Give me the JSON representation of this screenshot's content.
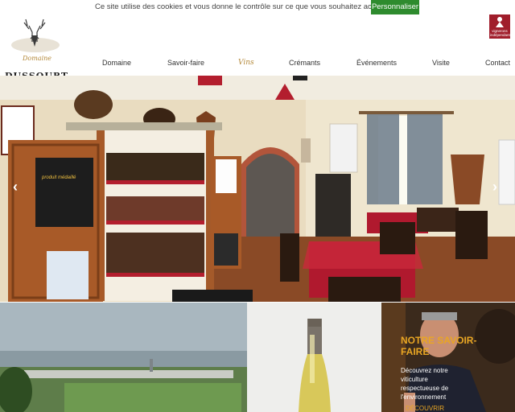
{
  "cookie": {
    "text": "Ce site utilise des cookies et vous donne le contrôle sur ce que vous souhaitez activer.",
    "button": "Personnaliser"
  },
  "logo": {
    "script": "Domaine",
    "name": "DUSSOURT"
  },
  "badge": {
    "line1": "vignerons",
    "line2": "indépendants"
  },
  "nav": [
    "Domaine",
    "Savoir-faire",
    "Vins",
    "Crémants",
    "Événements",
    "Visite",
    "Contact"
  ],
  "hero": {
    "prev_icon": "‹",
    "next_icon": "›",
    "poster_text": "produit médaillé"
  },
  "tile3": {
    "title": "NOTRE SAVOIR-FAIRE",
    "text": "Découvrez notre viticulture respectueuse de l'environnement",
    "link": "DÉCOUVRIR"
  },
  "colors": {
    "accent": "#b58a3c",
    "cookie_button": "#2e8b2e",
    "badge": "#a01d2b",
    "tile_title": "#e9a623"
  }
}
